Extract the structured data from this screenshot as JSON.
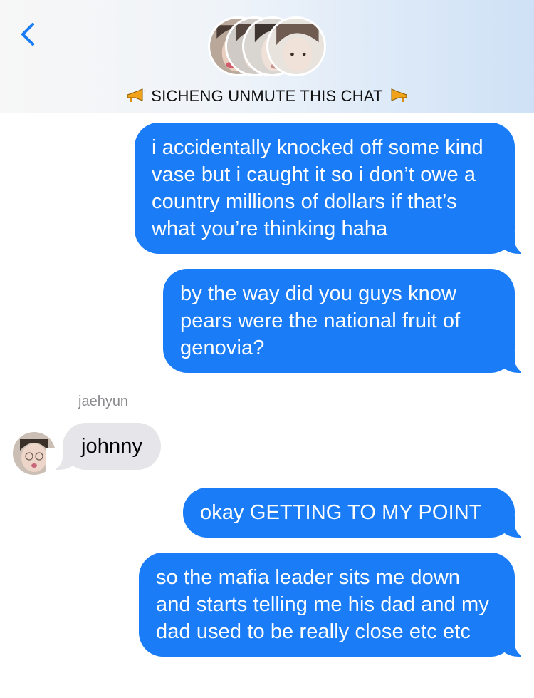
{
  "header": {
    "back_icon": "chevron-left-icon",
    "accent_color": "#1a7cf6",
    "chat_title": "SICHENG UNMUTE THIS CHAT",
    "title_emoji": "megaphone-icon",
    "group_avatars": [
      "avatar-1",
      "avatar-2",
      "avatar-3",
      "avatar-4"
    ]
  },
  "messages": [
    {
      "direction": "outgoing",
      "text": "i accidentally knocked off some kind vase but i caught it so i don’t owe a country millions of dollars if that’s what you’re thinking haha"
    },
    {
      "direction": "outgoing",
      "text": "by the way did you guys know pears were the national fruit of genovia?"
    },
    {
      "direction": "incoming",
      "sender": "jaehyun",
      "text": "johnny"
    },
    {
      "direction": "outgoing",
      "text": "okay GETTING TO MY POINT"
    },
    {
      "direction": "outgoing",
      "text": "so the mafia leader sits me down and starts telling me his dad and my dad used to be really close etc etc"
    }
  ],
  "colors": {
    "outgoing_bubble": "#1a7cf6",
    "incoming_bubble": "#e5e5ea",
    "sender_label": "#8a8a8f"
  }
}
